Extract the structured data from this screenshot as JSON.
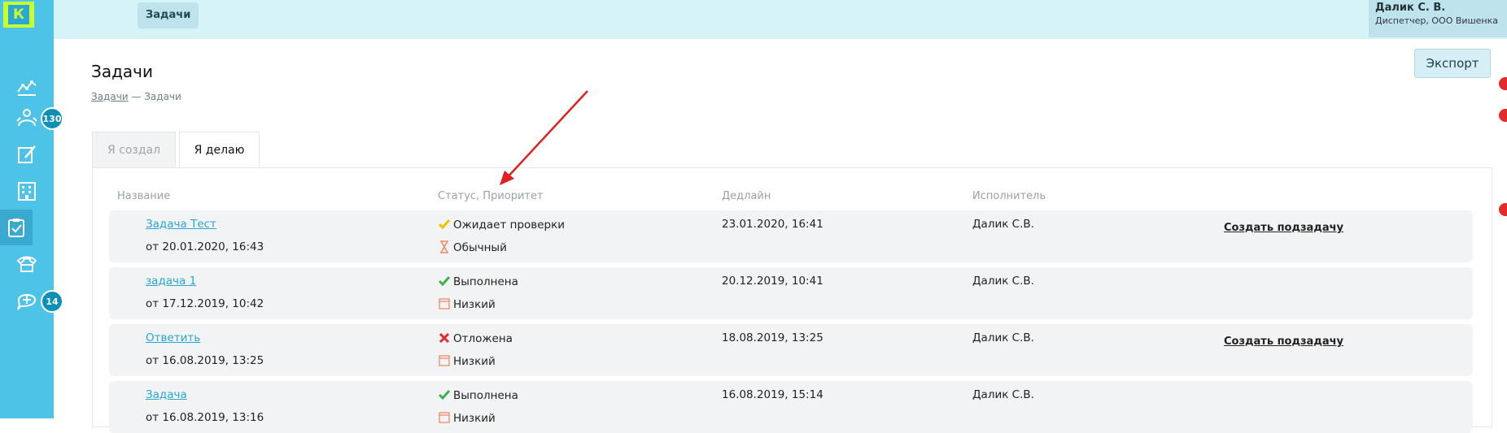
{
  "sidebar": {
    "logo_letter": "К",
    "badges": {
      "tasks": "130",
      "chat": "14"
    }
  },
  "topbar": {
    "button_label": "Задачи",
    "user_name": "Далик С. В.",
    "user_role": "Диспетчер, ООО Вишенка"
  },
  "page": {
    "title": "Задачи",
    "breadcrumb_link": "Задачи",
    "breadcrumb_sep": " — ",
    "breadcrumb_current": "Задачи",
    "export_label": "Экспорт"
  },
  "tabs": [
    "Я создал",
    "Я делаю"
  ],
  "table": {
    "headers": [
      "Название",
      "Статус, Приоритет",
      "Дедлайн",
      "Исполнитель"
    ],
    "rows": [
      {
        "name": "Задача Тест",
        "created": "от 20.01.2020, 16:43",
        "status": "Ожидает проверки",
        "priority": "Обычный",
        "deadline": "23.01.2020, 16:41",
        "executor": "Далик С.В.",
        "action": "Создать подзадачу"
      },
      {
        "name": "задача 1",
        "created": "от 17.12.2019, 10:42",
        "status": "Выполнена",
        "priority": "Низкий",
        "deadline": "20.12.2019, 10:41",
        "executor": "Далик С.В.",
        "action": ""
      },
      {
        "name": "Ответить",
        "created": "от 16.08.2019, 13:25",
        "status": "Отложена",
        "priority": "Низкий",
        "deadline": "18.08.2019, 13:25",
        "executor": "Далик С.В.",
        "action": "Создать подзадачу"
      },
      {
        "name": "Задача",
        "created": "от 16.08.2019, 13:16",
        "status": "Выполнена",
        "priority": "Низкий",
        "deadline": "16.08.2019, 15:14",
        "executor": "Далик С.В.",
        "action": ""
      }
    ]
  },
  "icons": {
    "nav": [
      "analytics-icon",
      "people-icon",
      "edit-icon",
      "building-icon",
      "tasks-icon",
      "phone-icon",
      "chat-add-icon"
    ],
    "status": [
      "check-yellow-icon",
      "check-green-icon",
      "cross-red-icon",
      "check-green-icon"
    ],
    "priority": [
      "hourglass-icon",
      "calendar-icon",
      "calendar-icon",
      "calendar-icon"
    ]
  },
  "colors": {
    "sidebar": "#4ec3e8",
    "accent": "#27a7d3",
    "logo": "#c8ff2e",
    "red": "#e32b2b",
    "green": "#3ab24a",
    "yellow": "#f2c200"
  }
}
